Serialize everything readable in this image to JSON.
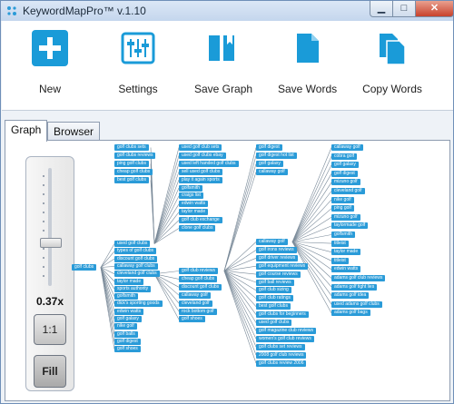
{
  "window": {
    "title": "KeywordMapPro™ v.1.10"
  },
  "toolbar": {
    "new_label": "New",
    "settings_label": "Settings",
    "save_graph_label": "Save Graph",
    "save_words_label": "Save Words",
    "copy_words_label": "Copy Words"
  },
  "tabs": {
    "graph_label": "Graph",
    "browser_label": "Browser"
  },
  "zoom": {
    "value": "0.37x",
    "one_to_one_label": "1:1",
    "fill_label": "Fill",
    "level": 0.37
  },
  "graph": {
    "root": "golf clubs",
    "col1": [
      "used golf clubs",
      "types of golf clubs",
      "discount golf clubs",
      "callaway golf clubs",
      "cleveland golf clubs",
      "taylor made",
      "sports authority",
      "golfsmith",
      "dick's sporting goods",
      "edwin watts",
      "golf galaxy",
      "nike golf",
      "golf balls",
      "golf digest",
      "golf shoes"
    ],
    "col2a": [
      "used golf club sets",
      "used golf clubs ebay",
      "used left handed golf clubs",
      "sell used golf clubs",
      "play it again sports",
      "golfsmith",
      "craigs list",
      "edwin watts",
      "taylor made",
      "golf club exchange",
      "clone golf clubs"
    ],
    "col2b": [
      "golf club reviews",
      "cheap golf clubs",
      "discount golf clubs",
      "callaway golf",
      "cleveland golf",
      "rock bottom golf",
      "golf shoes"
    ],
    "col0": [
      "golf clubs sets",
      "golf clubs reviews",
      "ping golf clubs",
      "cheap golf clubs",
      "best golf clubs"
    ],
    "col3a": [
      "golf digest",
      "golf digest hot list",
      "golf galaxy",
      "callaway golf"
    ],
    "col3b": [
      "callaway golf",
      "golf irons reviews",
      "golf driver reviews",
      "golf equipment reviews",
      "golf course reviews",
      "golf ball reviews",
      "golf club sizing",
      "golf club ratings",
      "best golf clubs",
      "golf clubs for beginners",
      "used golf clubs",
      "golf magazine club reviews",
      "women's golf club reviews",
      "golf clubs set reviews",
      "2008 golf club reviews",
      "golf clubs review 2006"
    ],
    "col4": [
      "callaway golf",
      "cobra golf",
      "golf galaxy",
      "golf digest",
      "mizuno golf",
      "cleveland golf",
      "nike golf",
      "ping golf",
      "mizuno golf",
      "taylormade golf",
      "golfsmith",
      "titleist",
      "taylor made",
      "titleist",
      "edwin watts",
      "adams golf club reviews",
      "adams golf tight lies",
      "adams golf idea",
      "used adams golf clubs",
      "adams golf bags"
    ]
  }
}
